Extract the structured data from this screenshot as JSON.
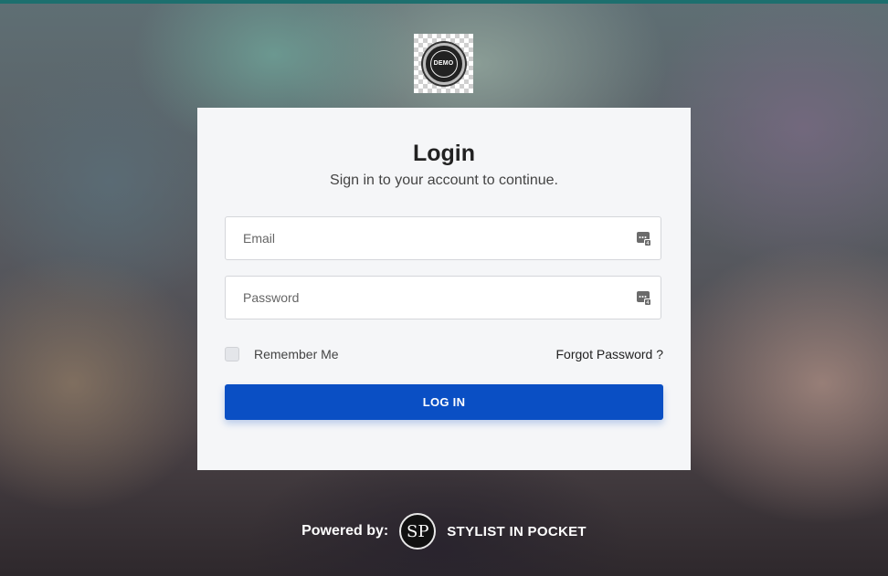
{
  "logo": {
    "text": "DEMO",
    "icon": "demo-logo-icon"
  },
  "login": {
    "title": "Login",
    "subtitle": "Sign in to your account to continue."
  },
  "form": {
    "email_placeholder": "Email",
    "password_placeholder": "Password",
    "remember_label": "Remember Me",
    "remember_checked": false,
    "forgot_label": "Forgot Password ?",
    "submit_label": "LOG IN",
    "field_icon": "password-manager-icon"
  },
  "footer": {
    "powered_label": "Powered by:",
    "brand_logo_text": "SP",
    "brand_name": "STYLIST IN POCKET"
  },
  "colors": {
    "primary_button": "#0a4fc4",
    "card_background": "#f5f6f8",
    "top_strip": "#1d6f6e"
  }
}
